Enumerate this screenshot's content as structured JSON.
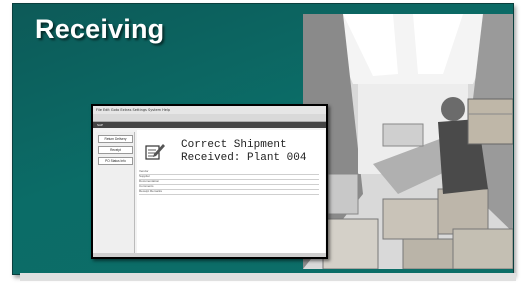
{
  "slide": {
    "title": "Receiving"
  },
  "photo": {
    "subject": "warehouse worker unloading boxes from a truck trailer"
  },
  "screenshot": {
    "menubar_text": "File  Edit  Goto  Extras  Settings  System  Help",
    "appbar_text": "SAP",
    "nav_buttons": [
      "Return Delivery",
      "Receipt",
      "PO Status Info"
    ],
    "message_line1": "Correct Shipment",
    "message_line2": "Received: Plant 004",
    "form_rows": [
      "Vendor",
      "Supplier",
      "Documentation",
      "Comments",
      "Receipt Remarks"
    ]
  },
  "colors": {
    "slide_bg": "#0b6c67",
    "title": "#ffffff"
  }
}
